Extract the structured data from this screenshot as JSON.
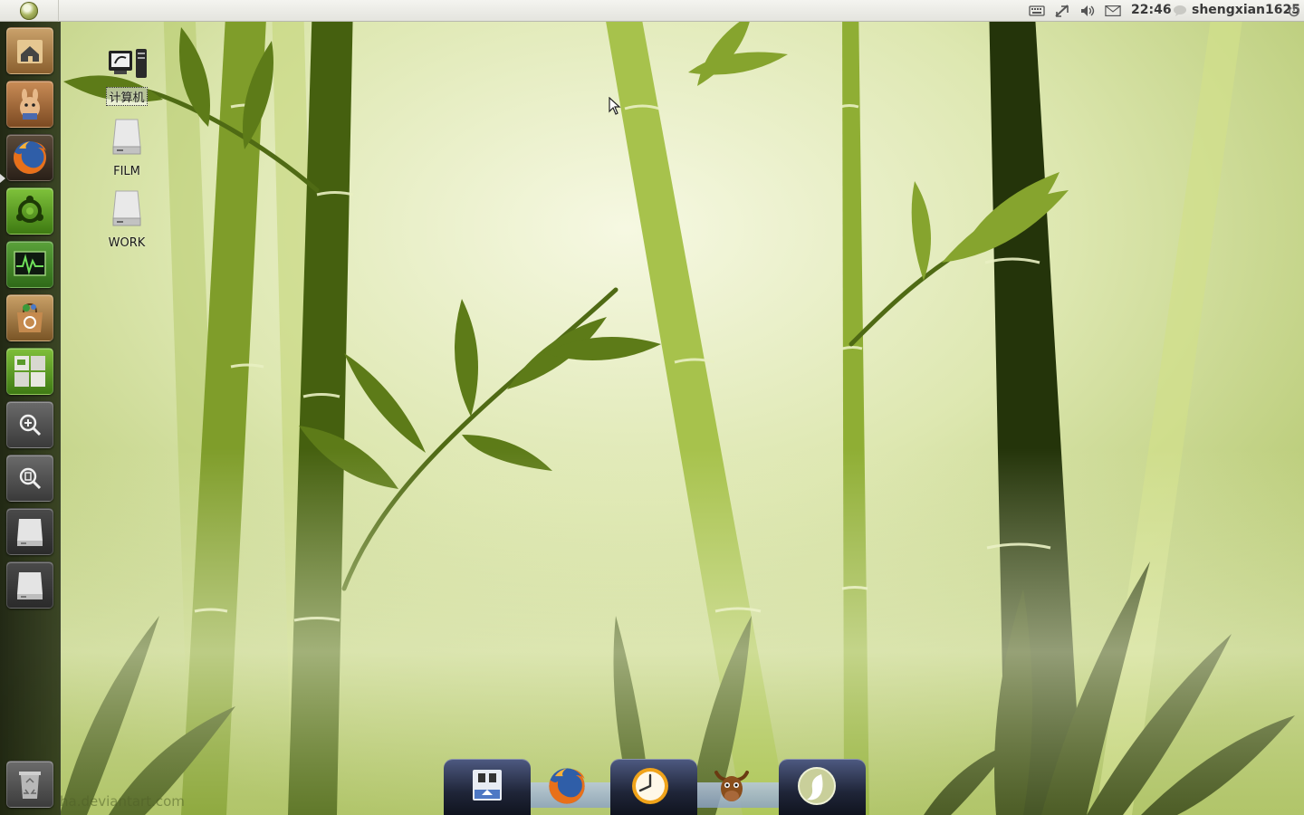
{
  "top_panel": {
    "time": "22:46",
    "username": "shengxian1625",
    "tray_icons": [
      "keyboard-icon",
      "network-icon",
      "volume-icon",
      "mail-icon",
      "chat-icon",
      "power-icon"
    ]
  },
  "launcher": {
    "items": [
      {
        "name": "home-folder",
        "icon": "home-folder-icon"
      },
      {
        "name": "hamster-app",
        "icon": "hamster-icon"
      },
      {
        "name": "firefox",
        "icon": "firefox-icon"
      },
      {
        "name": "ubuntu-tweak",
        "icon": "ubuntu-tweak-icon"
      },
      {
        "name": "system-monitor",
        "icon": "system-monitor-icon"
      },
      {
        "name": "software-center",
        "icon": "software-center-icon"
      },
      {
        "name": "workspace-switcher",
        "icon": "workspace-switcher-icon"
      },
      {
        "name": "applications-lens",
        "icon": "apps-search-icon"
      },
      {
        "name": "files-lens",
        "icon": "files-search-icon"
      },
      {
        "name": "drive-1",
        "icon": "drive-icon"
      },
      {
        "name": "drive-2",
        "icon": "drive-icon"
      },
      {
        "name": "trash",
        "icon": "trash-icon"
      }
    ]
  },
  "desktop": {
    "icons": [
      {
        "label": "计算机",
        "icon": "computer-icon",
        "selected": true
      },
      {
        "label": "FILM",
        "icon": "drive-icon"
      },
      {
        "label": "WORK",
        "icon": "drive-icon"
      }
    ]
  },
  "dock": {
    "items": [
      {
        "name": "docky-settings",
        "icon": "docky-settings-icon"
      },
      {
        "name": "firefox",
        "icon": "firefox-icon"
      },
      {
        "name": "clock",
        "icon": "clock-icon"
      },
      {
        "name": "moose-app",
        "icon": "moose-icon"
      },
      {
        "name": "gnome-foot",
        "icon": "gnome-foot-icon"
      }
    ]
  },
  "watermark": "ha.deviantart.com",
  "colors": {
    "wallpaper_light": "#f3f6d8",
    "wallpaper_mid": "#c9d98f",
    "bamboo_dark": "#2e3d0c",
    "bamboo_mid": "#6f8a22",
    "bamboo_light": "#a8c14e",
    "launcher_bg": "#1e2510",
    "panel_bg": "#ecece6"
  }
}
